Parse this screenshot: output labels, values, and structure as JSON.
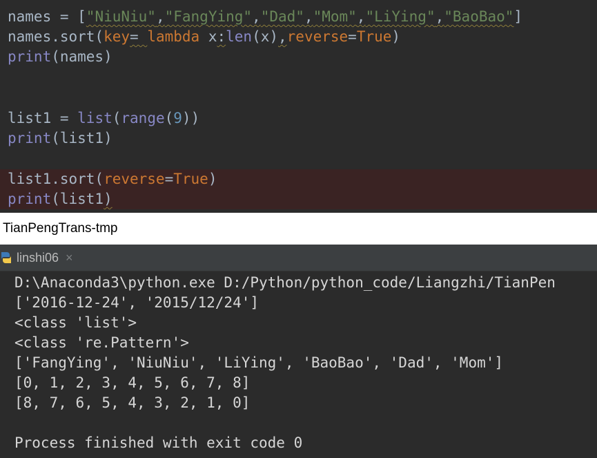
{
  "editor": {
    "line1": {
      "names": "names",
      "eq": " = [",
      "s1": "\"NiuNiu\"",
      "c1": ",",
      "s2": "\"FangYing\"",
      "c2": ",",
      "s3": "\"Dad\"",
      "c3": ",",
      "s4": "\"Mom\"",
      "c4": ",",
      "s5": "\"LiYing\"",
      "c5": ",",
      "s6": "\"BaoBao\"",
      "end": "]"
    },
    "line2": {
      "a": "names.sort(",
      "key": "key",
      "b": "= ",
      "lambda": "lambda",
      "c": " x",
      "colon": ":",
      "len": "len",
      "d": "(x)",
      "comma": ",",
      "reverse": "reverse",
      "e": "=",
      "true": "True",
      "f": ")"
    },
    "line3": {
      "print": "print",
      "a": "(names)"
    },
    "line4": {
      "a": "list1 = ",
      "list": "list",
      "b": "(",
      "range": "range",
      "c": "(",
      "num": "9",
      "d": "))"
    },
    "line5": {
      "print": "print",
      "a": "(list1)"
    },
    "line6": {
      "a": "list1.sort(",
      "reverse": "reverse",
      "b": "=",
      "true": "True",
      "c": ")"
    },
    "line7": {
      "print": "print",
      "a": "(list1",
      "b": ")"
    }
  },
  "window_title": "TianPengTrans-tmp",
  "run_tab": {
    "label": "linshi06",
    "close": "×"
  },
  "console": {
    "lines": [
      "D:\\Anaconda3\\python.exe D:/Python/python_code/Liangzhi/TianPen",
      "['2016-12-24', '2015/12/24']",
      "<class 'list'>",
      "<class 're.Pattern'>",
      "['FangYing', 'NiuNiu', 'LiYing', 'BaoBao', 'Dad', 'Mom']",
      "[0, 1, 2, 3, 4, 5, 6, 7, 8]",
      "[8, 7, 6, 5, 4, 3, 2, 1, 0]",
      "",
      "Process finished with exit code 0"
    ]
  },
  "colors": {
    "background": "#2b2b2b",
    "keyword": "#cc7832",
    "string": "#6a8759",
    "number": "#6897bb",
    "builtin": "#8888c6",
    "default_text": "#a9b7c6",
    "highlight_row": "#3a2323"
  }
}
